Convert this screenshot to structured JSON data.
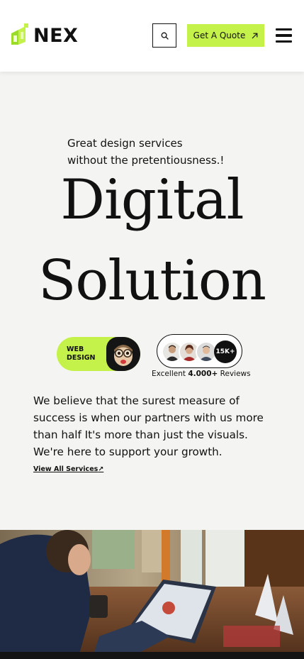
{
  "header": {
    "logo_text": "NEX",
    "search_icon": "search-icon",
    "quote_label": "Get A Quote",
    "quote_icon": "arrow-up-right-icon",
    "menu_icon": "hamburger-menu-icon"
  },
  "hero": {
    "tagline_line1": "Great design services",
    "tagline_line2": "without the pretentiousness.!",
    "headline_line1": "Digital",
    "headline_line2": "Solution",
    "service_pill": {
      "line1": "WEB",
      "line2": "DESIGN"
    },
    "reviews": {
      "count_badge": "15K+",
      "caption_prefix": "Excellent ",
      "caption_number": "4.000+",
      "caption_suffix": " Reviews"
    },
    "body": "We believe that the surest measure of success is when our partners with us more than half It's more than just the visuals. We're here to support your growth.",
    "link_label": "View All Services"
  },
  "colors": {
    "accent": "#c4f24a",
    "background": "#f4f4f2",
    "text": "#111111"
  }
}
